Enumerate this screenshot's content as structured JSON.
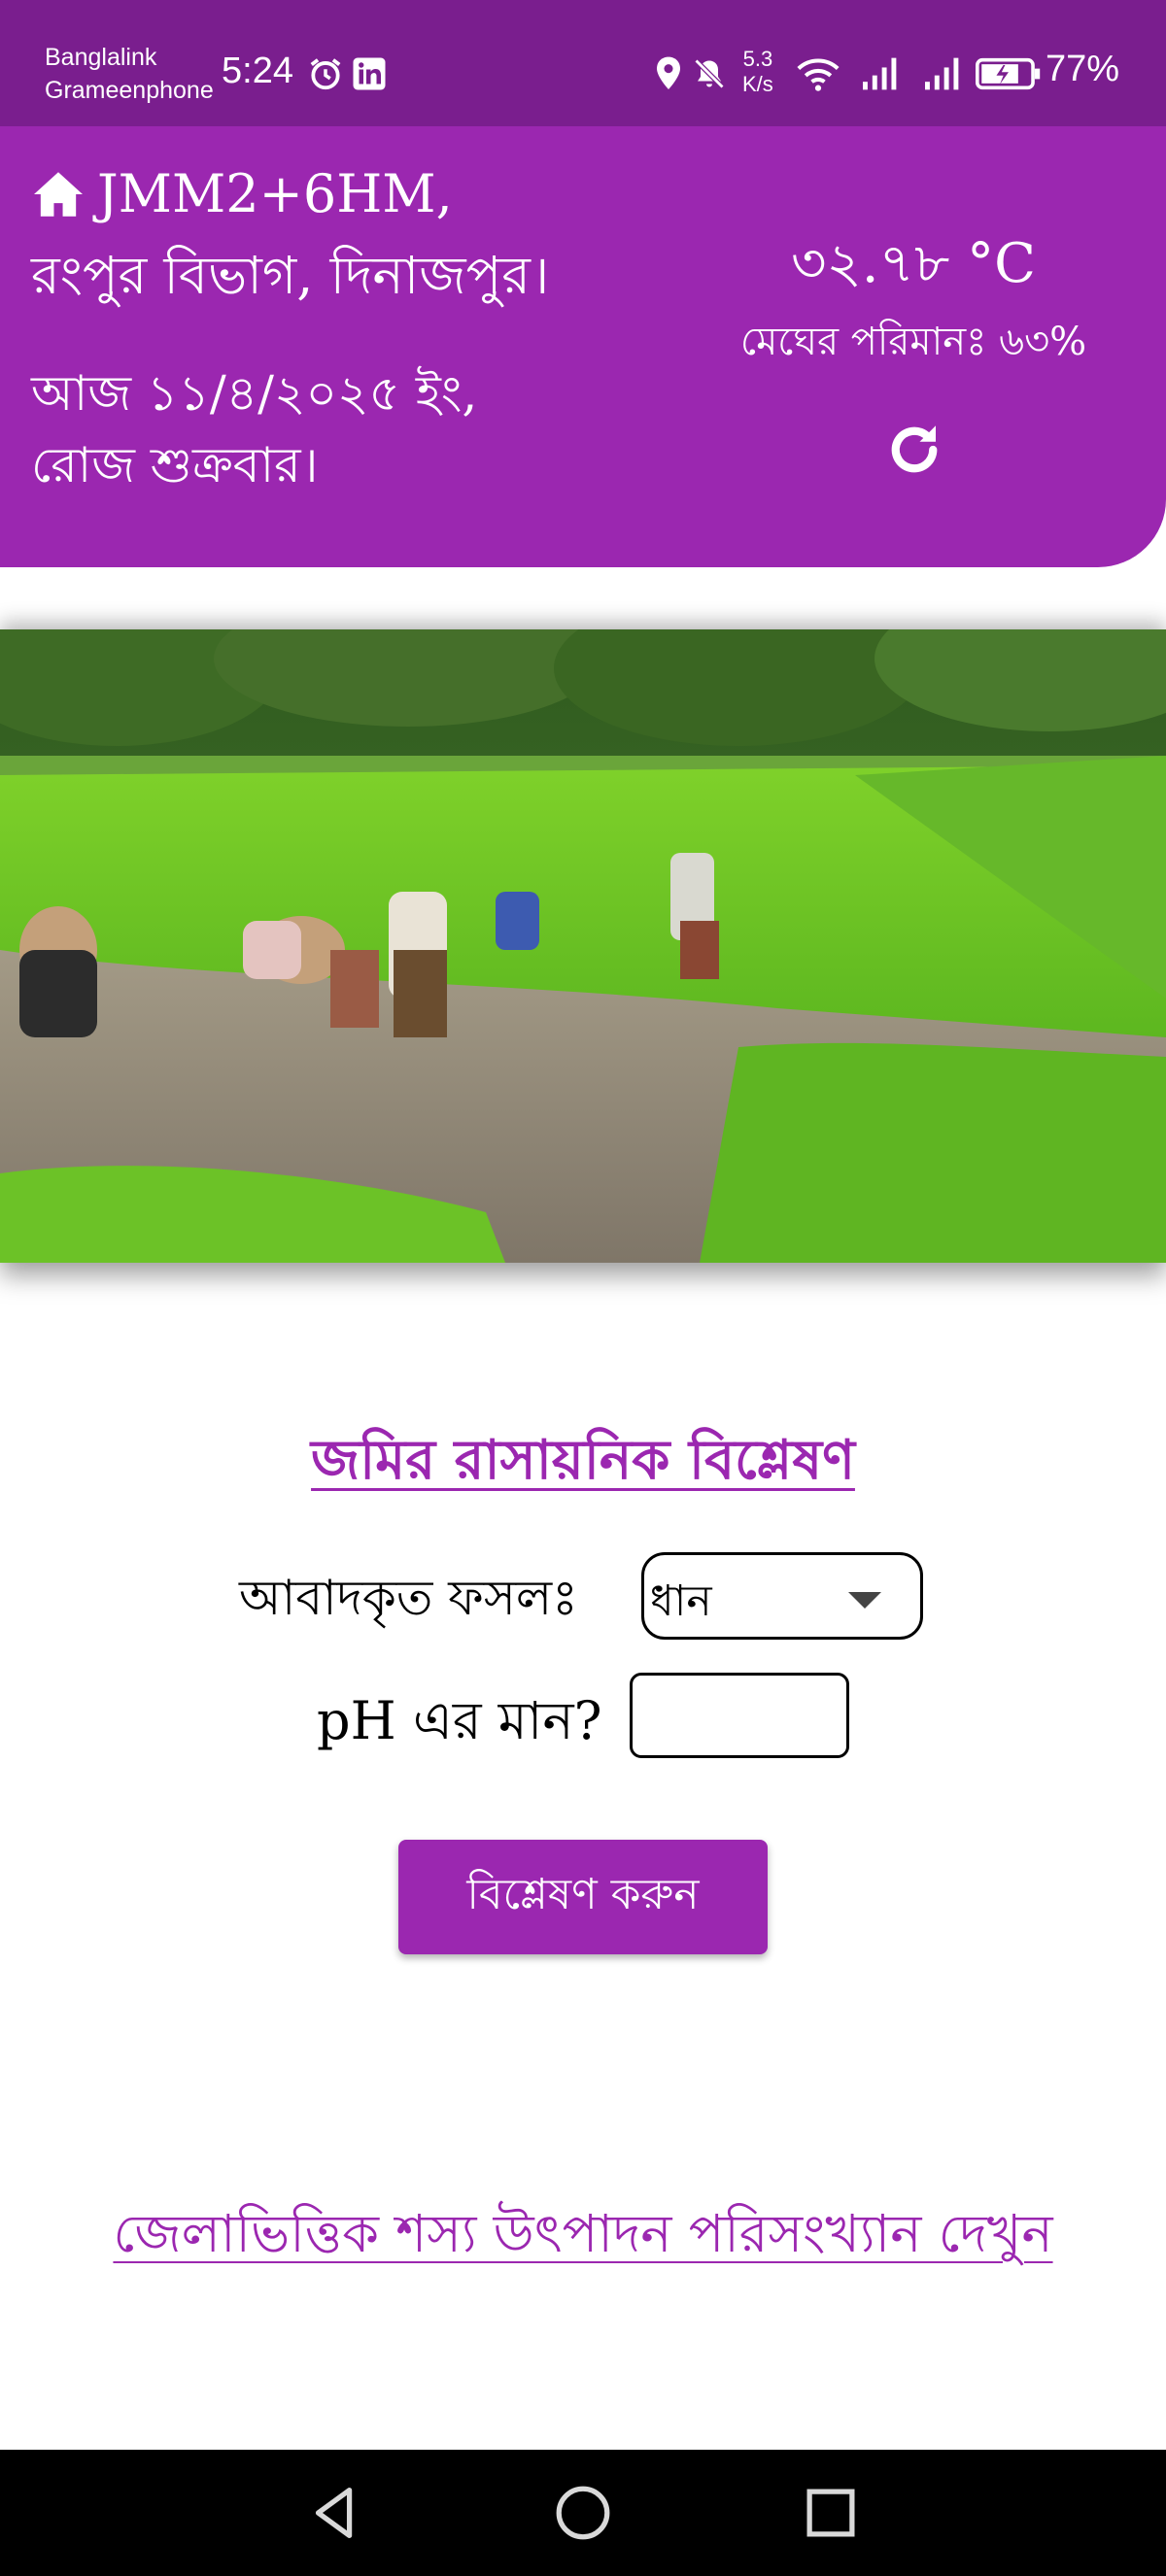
{
  "status_bar": {
    "carrier_1": "Banglalink",
    "carrier_2": "Grameenphone",
    "time": "5:24",
    "net_speed_value": "5.3",
    "net_speed_unit": "K/s",
    "battery_percent": "77%",
    "icons": [
      "alarm-icon",
      "linkedin-icon",
      "location-icon",
      "mute-icon",
      "wifi-icon",
      "signal-icon",
      "signal-icon",
      "battery-icon"
    ]
  },
  "header": {
    "location_line1": "JMM2+6HM,",
    "location_line2": "রংপুর বিভাগ, দিনাজপুর।",
    "date_line1": "আজ ১১/৪/২০২৫ ইং,",
    "date_line2": "রোজ শুক্রবার।",
    "temperature": "৩২.৭৮ °C",
    "cloud_cover": "মেঘের পরিমানঃ ৬৩%",
    "colors": {
      "primary": "#9b27b0",
      "status_bar": "#7a1e8e"
    }
  },
  "analysis": {
    "title": "জমির রাসায়নিক বিশ্লেষণ",
    "crop_label": "আবাদকৃত ফসলঃ",
    "crop_selected": "ধান",
    "ph_label": "pH এর মান?",
    "ph_value": "",
    "analyze_button": "বিশ্লেষণ করুন"
  },
  "stats_link": "জেলাভিত্তিক শস্য উৎপাদন পরিসংখ্যান দেখুন",
  "nav": {
    "icons": [
      "back-icon",
      "home-icon",
      "recents-icon"
    ]
  }
}
